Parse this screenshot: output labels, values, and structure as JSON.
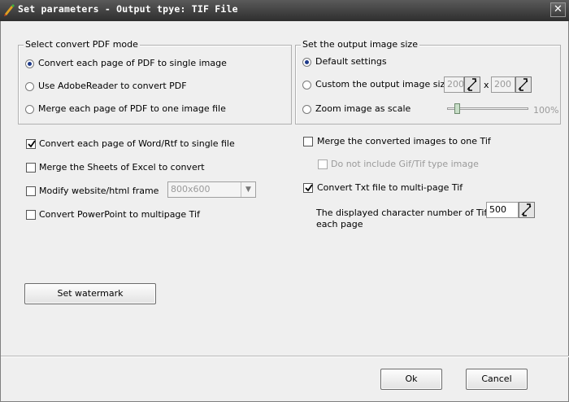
{
  "window": {
    "title": "Set parameters - Output tpye: TIF File",
    "close_glyph": "✕"
  },
  "pdf_mode": {
    "legend": "Select convert PDF mode",
    "options": [
      {
        "label": "Convert each page of PDF to single image",
        "checked": true
      },
      {
        "label": "Use AdobeReader to convert PDF",
        "checked": false
      },
      {
        "label": "Merge each page of PDF to one image file",
        "checked": false
      }
    ]
  },
  "image_size": {
    "legend": "Set the output image size",
    "default_label": "Default settings",
    "default_checked": true,
    "custom_label": "Custom the output image size",
    "custom_width": "200",
    "custom_times": "x",
    "custom_height": "200",
    "zoom_label": "Zoom image as scale",
    "zoom_value": "100%",
    "zoom_level_fraction": 0.1
  },
  "left_options": {
    "word_rtf_label": "Convert each page of Word/Rtf to single file",
    "word_rtf_checked": true,
    "excel_label": "Merge the Sheets of Excel to convert",
    "excel_checked": false,
    "website_label": "Modify website/html frame",
    "website_checked": false,
    "website_frame_value": "800x600",
    "powerpoint_label": "Convert PowerPoint to multipage Tif",
    "powerpoint_checked": false
  },
  "right_options": {
    "merge_label": "Merge the converted images to one Tif",
    "merge_checked": false,
    "no_gif_label": "Do not include Gif/Tif type image",
    "txt_label": "Convert Txt file to multi-page Tif",
    "txt_checked": true,
    "char_number_line1": "The displayed character number of Tif",
    "char_number_line2": "each page",
    "char_number_value": "500"
  },
  "buttons": {
    "watermark": "Set watermark",
    "ok": "Ok",
    "cancel": "Cancel"
  },
  "icons": {
    "app": "app-pencil-icon",
    "close": "close-icon",
    "spin": "spin-arrows-icon",
    "dropdown": "chevron-down-icon",
    "check": "checkmark-icon"
  },
  "colors": {
    "title_bar": "#3f3f3f",
    "dialog_bg": "#efefef",
    "radio_dot": "#1e3a8a"
  }
}
